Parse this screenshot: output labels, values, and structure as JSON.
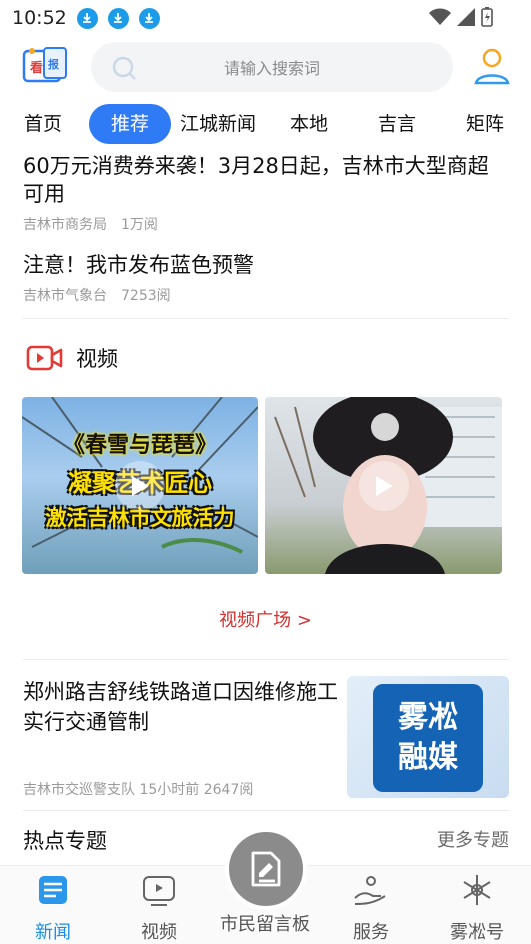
{
  "status_bar": {
    "time": "10:52"
  },
  "header": {
    "search_placeholder": "请输入搜索词"
  },
  "tabs": [
    {
      "label": "首页"
    },
    {
      "label": "推荐",
      "active": true
    },
    {
      "label": "江城新闻"
    },
    {
      "label": "本地"
    },
    {
      "label": "吉言"
    },
    {
      "label": "矩阵"
    }
  ],
  "articles": [
    {
      "title": "60万元消费券来袭！3月28日起，吉林市大型商超可用",
      "source": "吉林市商务局",
      "views": "1万阅"
    },
    {
      "title": "注意！我市发布蓝色预警",
      "source": "吉林市气象台",
      "views": "7253阅"
    }
  ],
  "video_section": {
    "title": "视频",
    "thumb1_lines": [
      "《春雪与琵琶》",
      "凝聚艺术匠心",
      "激活吉林市文旅活力"
    ],
    "more": "视频广场 >"
  },
  "feature": {
    "title": "郑州路吉舒线铁路道口因维修施工实行交通管制",
    "source": "吉林市交巡警支队",
    "time": "15小时前",
    "views": "2647阅",
    "image_text": [
      "雾凇",
      "融媒"
    ]
  },
  "hot_topics": {
    "title": "热点专题",
    "more": "更多专题"
  },
  "bottom_nav": [
    {
      "label": "新闻",
      "active": true
    },
    {
      "label": "视频"
    },
    {
      "label": "市民留言板"
    },
    {
      "label": "服务"
    },
    {
      "label": "雾凇号"
    }
  ],
  "colors": {
    "accent": "#2f7bf5",
    "red": "#d32f2f",
    "nav_active": "#1c8de6"
  }
}
